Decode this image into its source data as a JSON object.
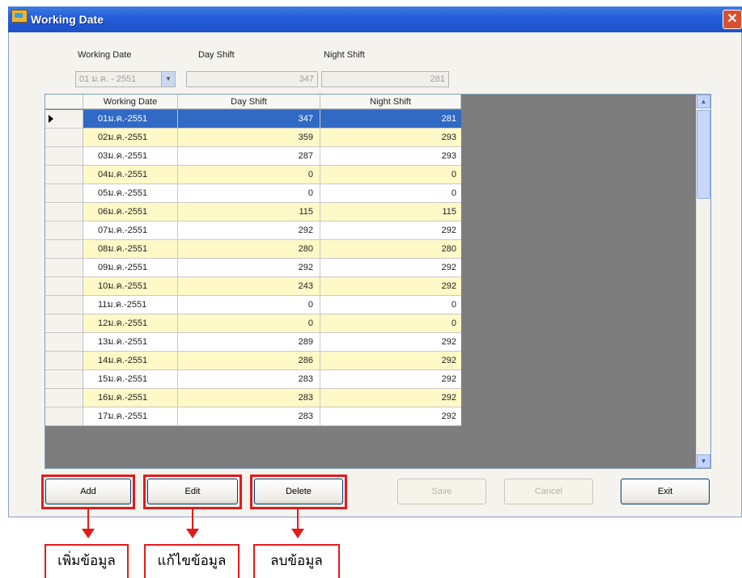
{
  "window": {
    "title": "Working Date",
    "close_glyph": "✕"
  },
  "filter": {
    "labels": {
      "working_date": "Working Date",
      "day_shift": "Day Shift",
      "night_shift": "Night Shift"
    },
    "working_date_value": "01 ม.ค. - 2551",
    "day_shift_value": "347",
    "night_shift_value": "281"
  },
  "grid": {
    "columns": [
      "Working Date",
      "Day Shift",
      "Night Shift"
    ],
    "rows": [
      {
        "date": "01ม.ค.-2551",
        "day": "347",
        "night": "281"
      },
      {
        "date": "02ม.ค.-2551",
        "day": "359",
        "night": "293"
      },
      {
        "date": "03ม.ค.-2551",
        "day": "287",
        "night": "293"
      },
      {
        "date": "04ม.ค.-2551",
        "day": "0",
        "night": "0"
      },
      {
        "date": "05ม.ค.-2551",
        "day": "0",
        "night": "0"
      },
      {
        "date": "06ม.ค.-2551",
        "day": "115",
        "night": "115"
      },
      {
        "date": "07ม.ค.-2551",
        "day": "292",
        "night": "292"
      },
      {
        "date": "08ม.ค.-2551",
        "day": "280",
        "night": "280"
      },
      {
        "date": "09ม.ค.-2551",
        "day": "292",
        "night": "292"
      },
      {
        "date": "10ม.ค.-2551",
        "day": "243",
        "night": "292"
      },
      {
        "date": "11ม.ค.-2551",
        "day": "0",
        "night": "0"
      },
      {
        "date": "12ม.ค.-2551",
        "day": "0",
        "night": "0"
      },
      {
        "date": "13ม.ค.-2551",
        "day": "289",
        "night": "292"
      },
      {
        "date": "14ม.ค.-2551",
        "day": "286",
        "night": "292"
      },
      {
        "date": "15ม.ค.-2551",
        "day": "283",
        "night": "292"
      },
      {
        "date": "16ม.ค.-2551",
        "day": "283",
        "night": "292"
      },
      {
        "date": "17ม.ค.-2551",
        "day": "283",
        "night": "292"
      }
    ],
    "selected_row": 0
  },
  "buttons": {
    "add": "Add",
    "edit": "Edit",
    "delete": "Delete",
    "save": "Save",
    "cancel": "Cancel",
    "exit": "Exit"
  },
  "annotations": {
    "add": "เพิ่มข้อมูล",
    "edit": "แก้ไขข้อมูล",
    "delete": "ลบข้อมูล"
  },
  "colors": {
    "highlight": "#e21b1b",
    "selection": "#316ac5",
    "alt_row": "#fff9c7",
    "titlebar": "#245edb"
  }
}
